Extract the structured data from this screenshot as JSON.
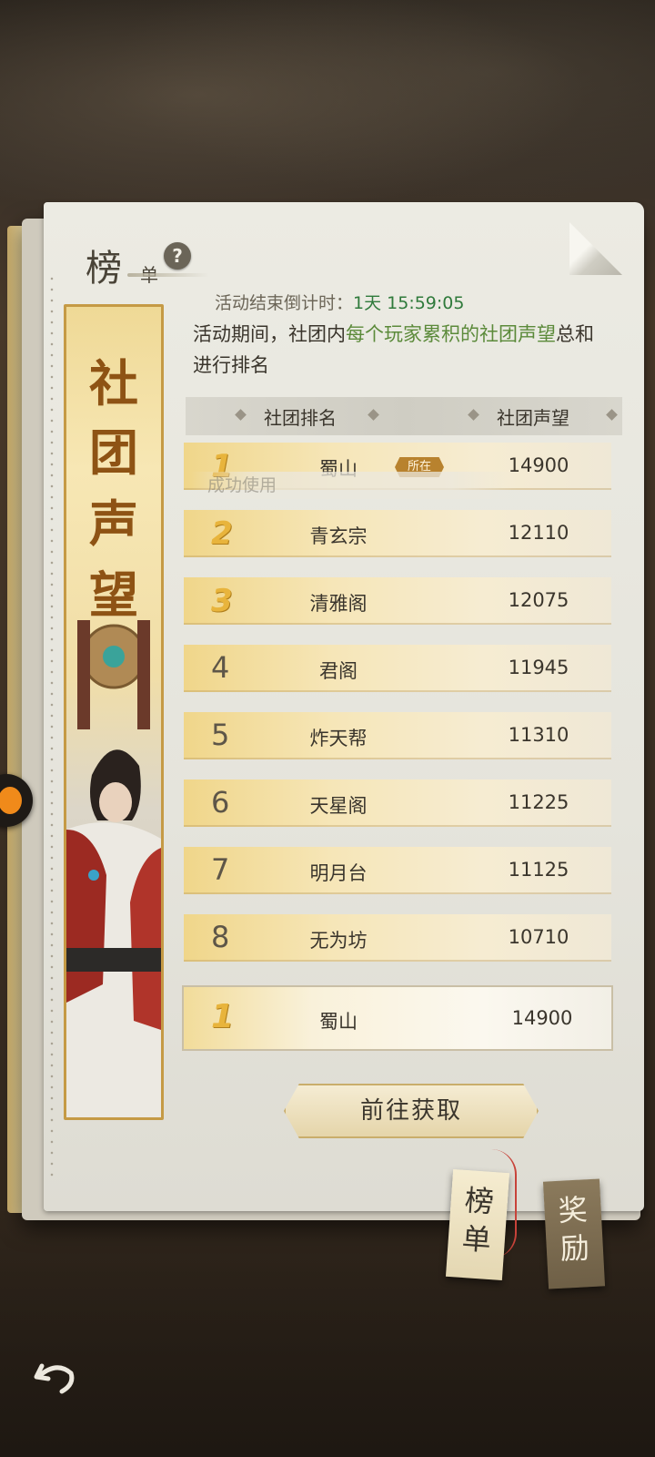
{
  "header": {
    "title_big": "榜",
    "title_small": "单",
    "help_icon": "question-icon"
  },
  "countdown": {
    "label": "活动结束倒计时：",
    "value": "1天 15:59:05"
  },
  "description": {
    "prefix": "活动期间，社团内",
    "highlight": "每个玩家累积的社团声望",
    "suffix": "总和进行排名"
  },
  "banner": {
    "chars": [
      "社",
      "团",
      "声",
      "望"
    ]
  },
  "table": {
    "col_rank_header": "社团排名",
    "col_score_header": "社团声望",
    "rows": [
      {
        "rank": "1",
        "name": "蜀山",
        "score": "14900",
        "tag": "所在"
      },
      {
        "rank": "2",
        "name": "青玄宗",
        "score": "12110"
      },
      {
        "rank": "3",
        "name": "清雅阁",
        "score": "12075"
      },
      {
        "rank": "4",
        "name": "君阁",
        "score": "11945"
      },
      {
        "rank": "5",
        "name": "炸天帮",
        "score": "11310"
      },
      {
        "rank": "6",
        "name": "天星阁",
        "score": "11225"
      },
      {
        "rank": "7",
        "name": "明月台",
        "score": "11125"
      },
      {
        "rank": "8",
        "name": "无为坊",
        "score": "10710"
      }
    ]
  },
  "toast": {
    "text": "成功使用"
  },
  "my_row": {
    "rank": "1",
    "name": "蜀山",
    "score": "14900"
  },
  "goto_button": {
    "label": "前往获取"
  },
  "tabs": {
    "ranking": "榜单",
    "reward": "奖励"
  },
  "back_icon": "back-arrow-icon"
}
